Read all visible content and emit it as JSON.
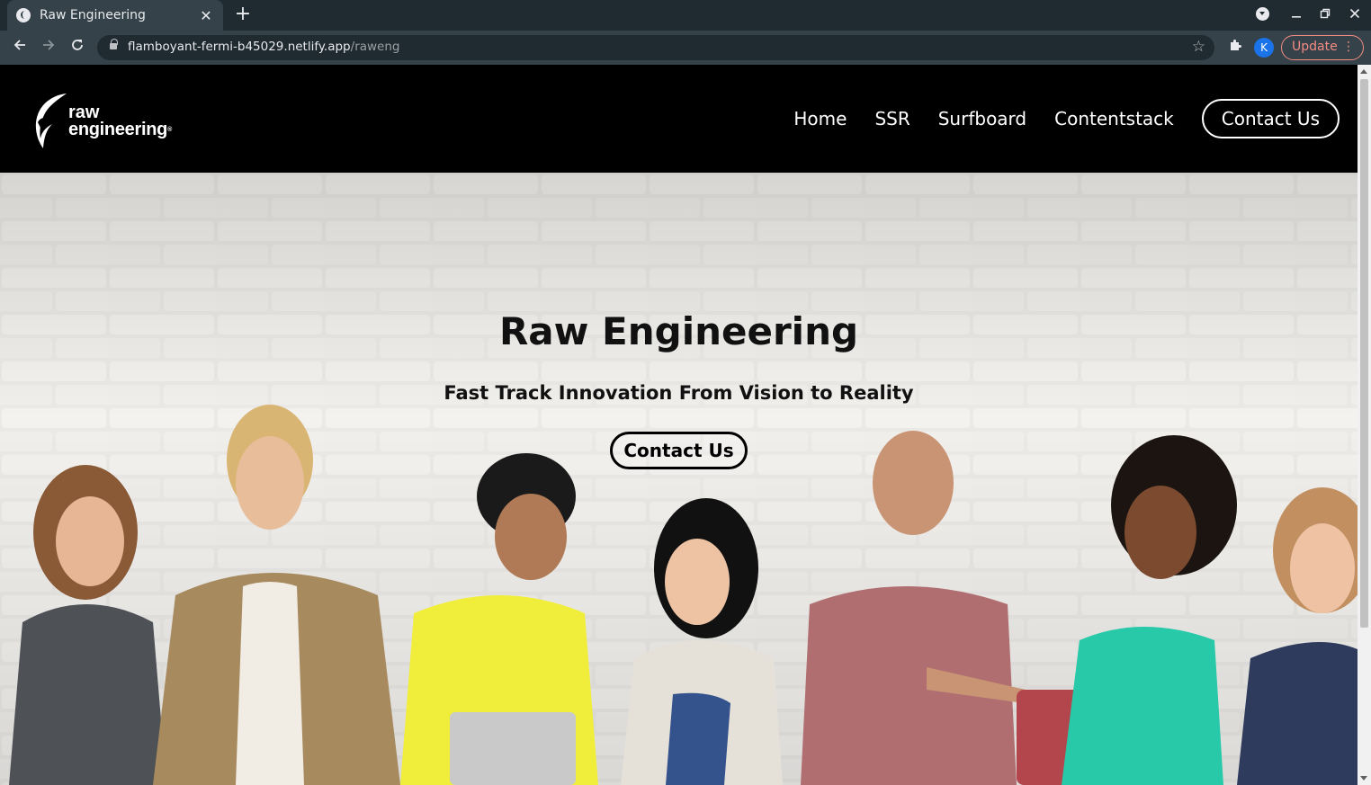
{
  "browser": {
    "tab_title": "Raw Engineering",
    "tab_close": "✕",
    "new_tab": "+",
    "url_host": "flamboyant-fermi-b45029.netlify.app",
    "url_path": "/raweng",
    "profile_initial": "K",
    "update_label": "Update",
    "update_menu": "⋮"
  },
  "header": {
    "logo": {
      "line1": "raw",
      "line2": "engineering",
      "reg": "®"
    },
    "nav": [
      {
        "label": "Home"
      },
      {
        "label": "SSR"
      },
      {
        "label": "Surfboard"
      },
      {
        "label": "Contentstack"
      }
    ],
    "contact_label": "Contact Us"
  },
  "hero": {
    "title": "Raw Engineering",
    "subtitle": "Fast Track Innovation From Vision to Reality",
    "cta_label": "Contact Us",
    "background": "people-sitting-against-white-brick-wall"
  },
  "colors": {
    "header_bg": "#000000",
    "chrome_tab_bar": "#1f2a31",
    "chrome_toolbar": "#35424a",
    "update_accent": "#f28b82",
    "profile_bg": "#1a73e8"
  }
}
